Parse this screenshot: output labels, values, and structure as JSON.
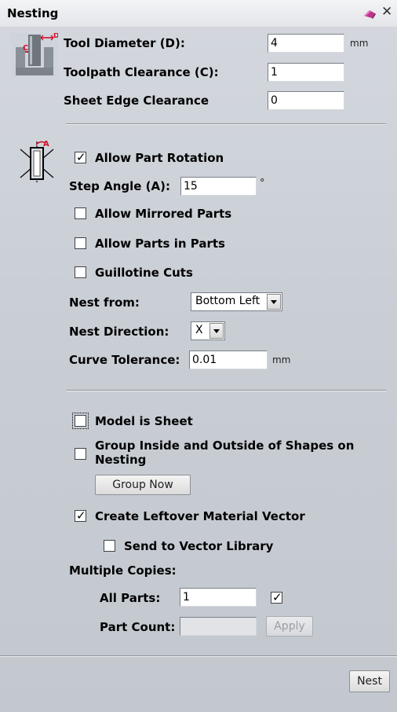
{
  "panel": {
    "title": "Nesting"
  },
  "tool": {
    "diameter_label": "Tool Diameter (D):",
    "diameter_value": "4",
    "diameter_unit": "mm",
    "clearance_label": "Toolpath Clearance (C):",
    "clearance_value": "1",
    "sheet_edge_label": "Sheet Edge Clearance",
    "sheet_edge_value": "0",
    "icon_c": "C",
    "icon_d": "D"
  },
  "rotation": {
    "allow_rotation_label": "Allow Part Rotation",
    "allow_rotation_checked": true,
    "step_angle_label": "Step Angle (A):",
    "step_angle_value": "15",
    "step_angle_unit": "°",
    "icon_a": "A",
    "mirrored_label": "Allow Mirrored Parts",
    "mirrored_checked": false,
    "parts_in_parts_label": "Allow Parts in Parts",
    "parts_in_parts_checked": false,
    "guillotine_label": "Guillotine Cuts",
    "guillotine_checked": false,
    "nest_from_label": "Nest from:",
    "nest_from_value": "Bottom Left",
    "nest_direction_label": "Nest Direction:",
    "nest_direction_value": "X",
    "curve_tol_label": "Curve Tolerance:",
    "curve_tol_value": "0.01",
    "curve_tol_unit": "mm"
  },
  "sheet": {
    "model_is_sheet_label": "Model is Sheet",
    "model_is_sheet_checked": false,
    "group_label_line1": "Group Inside and Outside of Shapes on",
    "group_label_line2": "Nesting",
    "group_checked": false,
    "group_now_button": "Group Now",
    "leftover_label": "Create Leftover Material Vector",
    "leftover_checked": true,
    "send_library_label": "Send to Vector Library",
    "send_library_checked": false,
    "multiple_copies_label": "Multiple Copies:",
    "all_parts_label": "All Parts:",
    "all_parts_value": "1",
    "all_parts_checked": true,
    "part_count_label": "Part Count:",
    "part_count_value": "",
    "apply_button": "Apply"
  },
  "footer": {
    "nest_button": "Nest"
  },
  "colors": {
    "panel_bg": "#c9ced5",
    "titlebar_bg": "#e9ebee",
    "pin_color": "#b0308a"
  },
  "icons": [
    "pin-icon",
    "close-icon",
    "tool-diameter-icon",
    "rotation-angle-icon"
  ]
}
